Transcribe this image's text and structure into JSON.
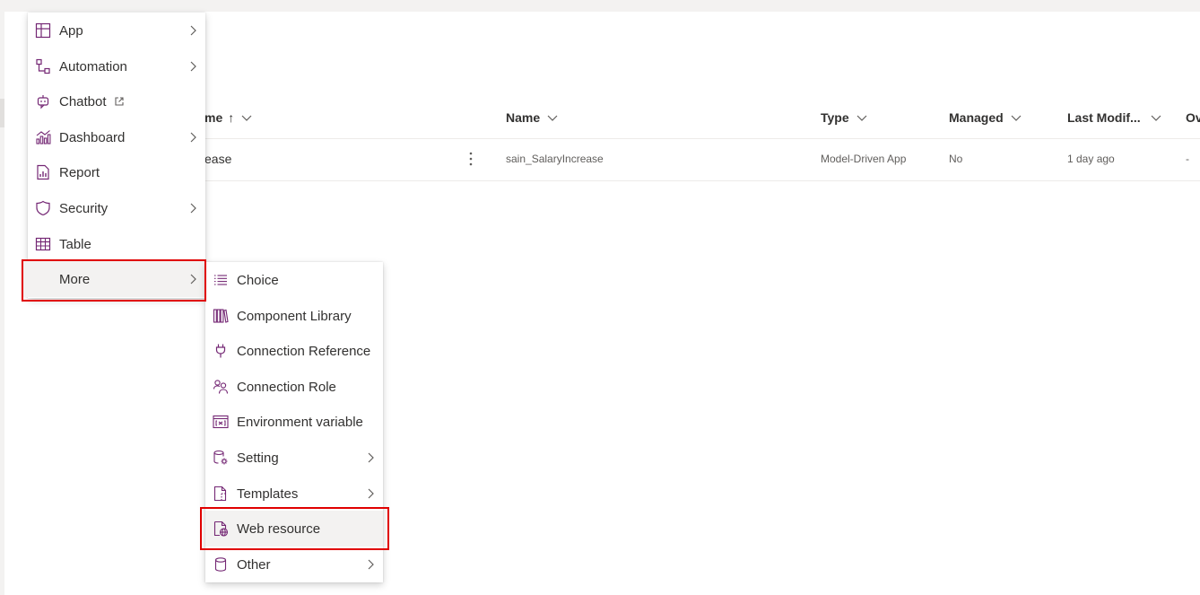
{
  "grid": {
    "columns": [
      {
        "label": "me",
        "sort": "↑"
      },
      {
        "label": "Name"
      },
      {
        "label": "Type"
      },
      {
        "label": "Managed"
      },
      {
        "label": "Last Modif..."
      },
      {
        "label": "Ov"
      }
    ],
    "rows": [
      {
        "display_name": "ease",
        "name": "sain_SalaryIncrease",
        "type": "Model-Driven App",
        "managed": "No",
        "last_modified": "1 day ago",
        "owner": "-"
      }
    ]
  },
  "new_menu": {
    "items": [
      {
        "label": "App",
        "icon": "app-icon",
        "submenu": true
      },
      {
        "label": "Automation",
        "icon": "automation-icon",
        "submenu": true
      },
      {
        "label": "Chatbot",
        "icon": "chatbot-icon",
        "external": true
      },
      {
        "label": "Dashboard",
        "icon": "dashboard-icon",
        "submenu": true
      },
      {
        "label": "Report",
        "icon": "report-icon"
      },
      {
        "label": "Security",
        "icon": "shield-icon",
        "submenu": true
      },
      {
        "label": "Table",
        "icon": "table-icon"
      },
      {
        "label": "More",
        "icon": "",
        "submenu": true,
        "highlighted": true
      }
    ]
  },
  "more_menu": {
    "items": [
      {
        "label": "Choice",
        "icon": "choice-icon"
      },
      {
        "label": "Component Library",
        "icon": "library-icon"
      },
      {
        "label": "Connection Reference",
        "icon": "plug-icon"
      },
      {
        "label": "Connection Role",
        "icon": "people-icon"
      },
      {
        "label": "Environment variable",
        "icon": "variable-icon"
      },
      {
        "label": "Setting",
        "icon": "settings-icon",
        "submenu": true
      },
      {
        "label": "Templates",
        "icon": "template-icon",
        "submenu": true
      },
      {
        "label": "Web resource",
        "icon": "web-resource-icon",
        "highlighted": true
      },
      {
        "label": "Other",
        "icon": "database-icon",
        "submenu": true
      }
    ]
  },
  "colors": {
    "icon_accent": "#742774",
    "highlight_border": "#e00000",
    "hover_bg": "#f3f2f1"
  }
}
